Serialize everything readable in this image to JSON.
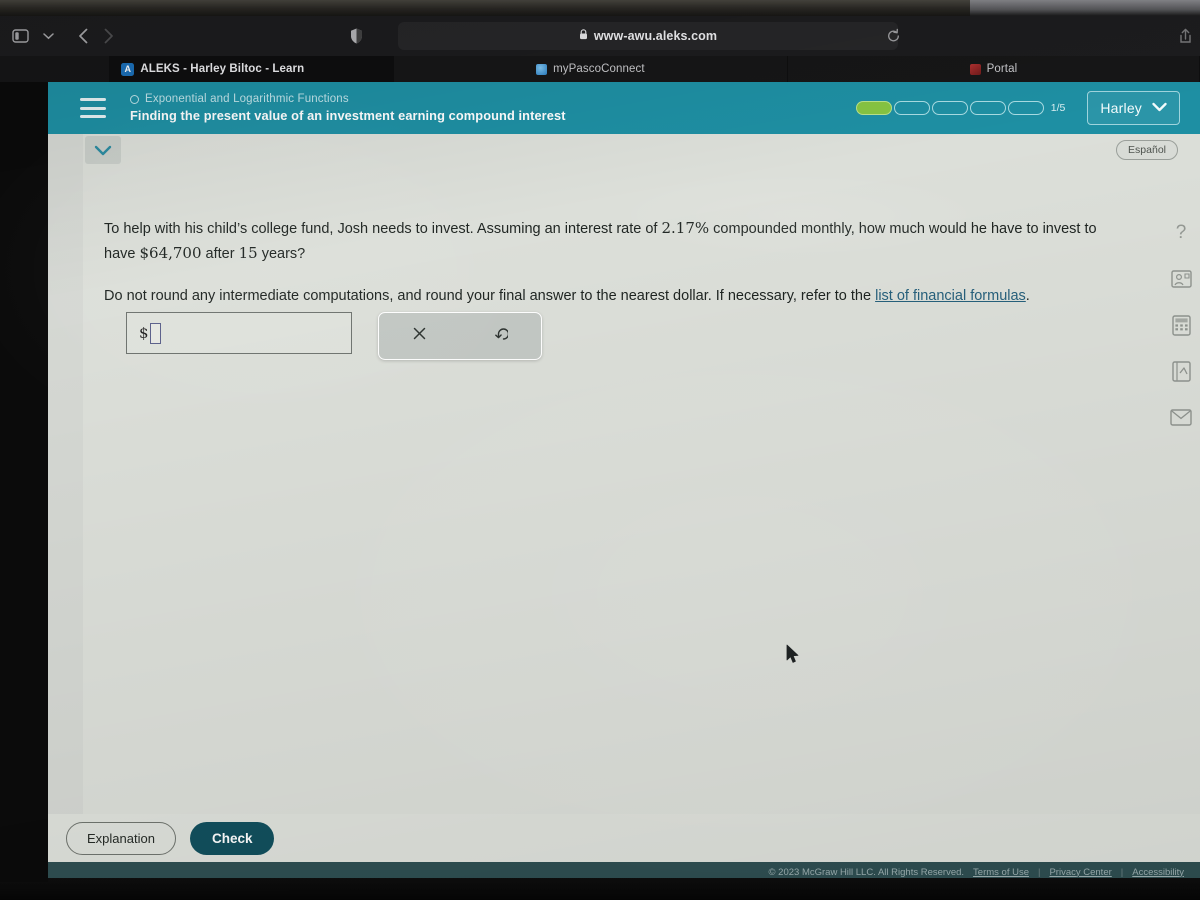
{
  "browser": {
    "url": "www-awu.aleks.com",
    "lock_glyph": "ὑ2",
    "icons": {
      "sidebar": "sidebar-toggle-icon",
      "chevron": "chevron-down-icon",
      "back": "back-arrow-icon",
      "forward": "forward-arrow-icon",
      "shield": "shield-privacy-icon",
      "reload": "reload-icon",
      "share": "share-icon"
    },
    "tabs": [
      {
        "label": "ALEKS - Harley Biltoc - Learn",
        "active": true,
        "favicon": "aleks-logo-icon"
      },
      {
        "label": "myPascoConnect",
        "active": false,
        "favicon": "pasco-favicon-icon"
      },
      {
        "label": "Portal",
        "active": false,
        "favicon": "portal-favicon-icon"
      }
    ]
  },
  "header": {
    "topic": "Exponential and Logarithmic Functions",
    "title": "Finding the present value of an investment earning compound interest",
    "progress": {
      "completed": 1,
      "total": 5,
      "label": "1/5"
    },
    "user": "Harley",
    "menu_icon": "hamburger-menu-icon",
    "user_chevron_icon": "chevron-down-icon"
  },
  "content": {
    "collapse_icon": "chevron-down-icon",
    "espanol_label": "Español",
    "question_part1": "To help with his child’s college fund, Josh needs to invest. Assuming an interest rate of ",
    "interest_rate": "2.17%",
    "question_part2": " compounded monthly, how much would he have to invest to have ",
    "amount": "$64,700",
    "question_part3": " after ",
    "years": "15",
    "question_part4": " years?",
    "instruction_part1": "Do not round any intermediate computations, and round your final answer to the nearest dollar. If necessary, refer to the ",
    "formulas_link": "list of financial formulas",
    "instruction_part2": "."
  },
  "answer": {
    "currency_symbol": "$",
    "value": "",
    "placeholder": "",
    "tools": {
      "clear_label": "×",
      "clear_name": "clear-icon",
      "undo_label": "↺",
      "undo_name": "undo-icon"
    }
  },
  "rail": {
    "items": [
      {
        "name": "help-question-icon",
        "glyph": "?"
      },
      {
        "name": "video-tutorial-icon",
        "glyph": ""
      },
      {
        "name": "calculator-icon",
        "glyph": ""
      },
      {
        "name": "reference-sheet-icon",
        "glyph": ""
      },
      {
        "name": "message-envelope-icon",
        "glyph": ""
      }
    ]
  },
  "actions": {
    "explanation_label": "Explanation",
    "check_label": "Check"
  },
  "footer": {
    "copyright": "© 2023 McGraw Hill LLC. All Rights Reserved.",
    "terms": "Terms of Use",
    "privacy": "Privacy Center",
    "accessibility": "Accessibility",
    "separator": "|"
  },
  "colors": {
    "teal_header": "#1e8fa3",
    "check_button": "#12505e",
    "progress_done": "#86c442",
    "footer_bar": "#2f4f52",
    "link": "#27607c"
  }
}
